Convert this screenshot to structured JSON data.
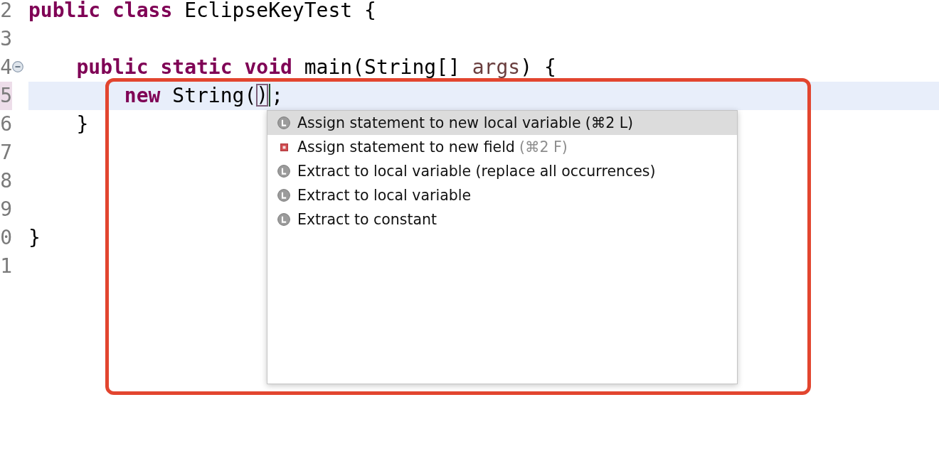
{
  "editor": {
    "lines": [
      {
        "number": "2",
        "current": false,
        "collapsible": false,
        "tokens": [
          {
            "kind": "keyword",
            "text": "public class"
          },
          {
            "kind": "plain",
            "text": " EclipseKeyTest {"
          }
        ]
      },
      {
        "number": "3",
        "current": false,
        "collapsible": false
      },
      {
        "number": "4",
        "current": false,
        "collapsible": true,
        "tokens": [
          {
            "kind": "keyword",
            "text": "    public static void"
          },
          {
            "kind": "plain",
            "text": " main(String[] "
          },
          {
            "kind": "parameter",
            "text": "args"
          },
          {
            "kind": "plain",
            "text": ") {"
          }
        ]
      },
      {
        "number": "5",
        "current": true,
        "collapsible": false,
        "tokens": [
          {
            "kind": "keyword",
            "text": "        new"
          },
          {
            "kind": "plain",
            "text": " String("
          },
          {
            "kind": "matched_bracket",
            "text": ")"
          },
          {
            "kind": "caret"
          },
          {
            "kind": "plain",
            "text": ";"
          }
        ]
      },
      {
        "number": "6",
        "current": false,
        "collapsible": false,
        "tokens": [
          {
            "kind": "plain",
            "text": "    }"
          }
        ]
      },
      {
        "number": "7",
        "current": false,
        "collapsible": false
      },
      {
        "number": "8",
        "current": false,
        "collapsible": false
      },
      {
        "number": "9",
        "current": false,
        "collapsible": false
      },
      {
        "number": "0",
        "current": false,
        "collapsible": false,
        "tokens": [
          {
            "kind": "plain",
            "text": "}"
          }
        ]
      },
      {
        "number": "1",
        "current": false,
        "collapsible": false
      }
    ]
  },
  "proposals": {
    "items": [
      {
        "kind": "local",
        "label": "Assign statement to new local variable",
        "shortcut": "(⌘2 L)",
        "selected": true
      },
      {
        "kind": "field",
        "label": "Assign statement to new field",
        "shortcut": "(⌘2 F)",
        "selected": false
      },
      {
        "kind": "local",
        "label": "Extract to local variable (replace all occurrences)",
        "selected": false
      },
      {
        "kind": "local",
        "label": "Extract to local variable",
        "selected": false
      },
      {
        "kind": "local",
        "label": "Extract to constant",
        "selected": false
      }
    ]
  }
}
